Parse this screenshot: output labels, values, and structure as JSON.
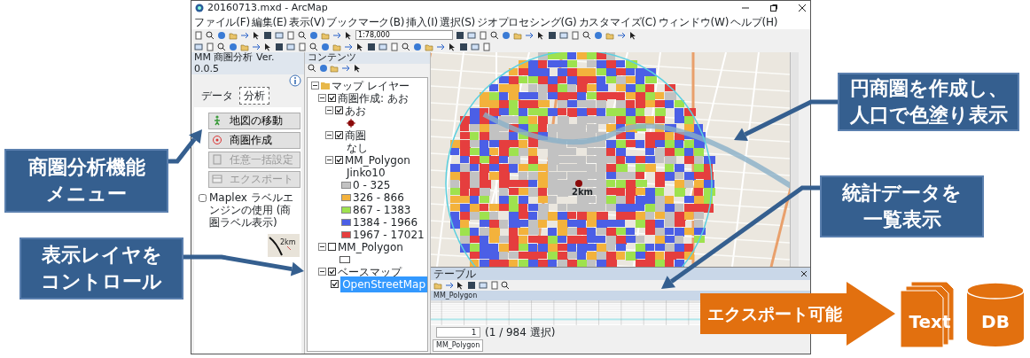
{
  "window": {
    "title": "20160713.mxd - ArcMap"
  },
  "menu": [
    "ファイル(F)",
    "編集(E)",
    "表示(V)",
    "ブックマーク(B)",
    "挿入(I)",
    "選択(S)",
    "ジオプロセシング(G)",
    "カスタマイズ(C)",
    "ウィンドウ(W)",
    "ヘルプ(H)"
  ],
  "toolbar": {
    "scale": "1:78,000"
  },
  "tool_panel": {
    "title": "MM 商圏分析  Ver. 0.0.5",
    "tabs": [
      {
        "label": "データ",
        "selected": false
      },
      {
        "label": "分析",
        "selected": true
      }
    ],
    "buttons": [
      {
        "label": "地図の移動",
        "disabled": false
      },
      {
        "label": "商圏作成",
        "disabled": false
      },
      {
        "label": "任意一括設定",
        "disabled": true
      },
      {
        "label": "エクスポート",
        "disabled": true
      }
    ],
    "option": {
      "label": "Maplex ラベルエンジンの使用 (商圏ラベル表示)",
      "checked": false
    },
    "preview_label": "2km"
  },
  "contents": {
    "title": "コンテンツ",
    "tree": [
      {
        "kind": "group",
        "label": "マップ レイヤー",
        "expanded": true,
        "children": [
          {
            "kind": "layer",
            "label": "商圏作成: あお",
            "checked": true,
            "expanded": true,
            "children": [
              {
                "kind": "layer",
                "label": "あお",
                "checked": true,
                "expanded": true,
                "children": [
                  {
                    "kind": "point",
                    "color": "#8b0a0a"
                  }
                ]
              },
              {
                "kind": "layer",
                "label": "商圏",
                "checked": true,
                "expanded": true,
                "children": [
                  {
                    "kind": "text",
                    "label": "なし"
                  }
                ]
              },
              {
                "kind": "layer",
                "label": "MM_Polygon",
                "checked": true,
                "expanded": true,
                "children": [
                  {
                    "kind": "text",
                    "label": "Jinko10"
                  },
                  {
                    "kind": "legend",
                    "label": "0 - 325",
                    "color": "#c2c2c2"
                  },
                  {
                    "kind": "legend",
                    "label": "326 - 866",
                    "color": "#f3b23c"
                  },
                  {
                    "kind": "legend",
                    "label": "867 - 1383",
                    "color": "#9ee24e"
                  },
                  {
                    "kind": "legend",
                    "label": "1384 - 1966",
                    "color": "#4b5fe6"
                  },
                  {
                    "kind": "legend",
                    "label": "1967 - 17021",
                    "color": "#e53e3e"
                  }
                ]
              }
            ]
          },
          {
            "kind": "layer",
            "label": "MM_Polygon",
            "checked": false,
            "expanded": true,
            "children": [
              {
                "kind": "fill"
              }
            ]
          },
          {
            "kind": "layer",
            "label": "ベースマップ",
            "checked": true,
            "expanded": true,
            "children": [
              {
                "kind": "layer",
                "label": "OpenStreetMap",
                "checked": true,
                "selected": true
              }
            ]
          }
        ]
      }
    ]
  },
  "map": {
    "center_label": "2km"
  },
  "table": {
    "title": "テーブル",
    "tab": "MM_Polygon",
    "record": "1",
    "selection": "(1 / 984 選択)",
    "bottom_tab": "MM_Polygon"
  },
  "callouts": [
    {
      "lines": [
        "商圏分析機能",
        "メニュー"
      ]
    },
    {
      "lines": [
        "表示レイヤを",
        "コントロール"
      ]
    },
    {
      "lines": [
        "円商圏を作成し、",
        "人口で色塗り表示"
      ]
    },
    {
      "lines": [
        "統計データを",
        "一覧表示"
      ]
    }
  ],
  "export": {
    "label": "エクスポート可能",
    "formats": [
      {
        "kind": "document",
        "label": "Text"
      },
      {
        "kind": "database",
        "label": "DB"
      }
    ]
  }
}
